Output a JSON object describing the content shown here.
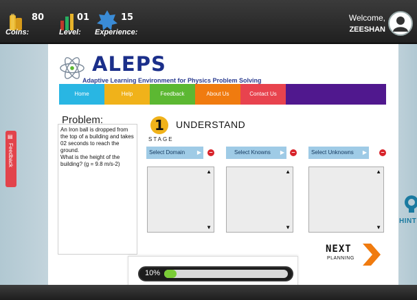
{
  "topbar": {
    "coins_value": "80",
    "coins_label": "Coins:",
    "level_value": "01",
    "level_label": "Level:",
    "experience_value": "15",
    "experience_label": "Experience:",
    "welcome_text": "Welcome,",
    "username": "ZEESHAN"
  },
  "logo": {
    "title": "ALEPS",
    "subtitle": "Adaptive Learning Environment for Physics Problem Solving"
  },
  "nav": {
    "items": [
      {
        "label": "Home",
        "color": "#29b6e3"
      },
      {
        "label": "Help",
        "color": "#f0b21a"
      },
      {
        "label": "Feedback",
        "color": "#5cb832"
      },
      {
        "label": "About Us",
        "color": "#f07b0f"
      },
      {
        "label": "Contact Us",
        "color": "#e8434e"
      }
    ]
  },
  "problem": {
    "title": "Problem:",
    "text": "An Iron ball is dropped from the top of a building and takes 02 seconds to reach the ground.\nWhat is the height of the building? (g = 9.8 m/s-2)"
  },
  "stage": {
    "number": "1",
    "name": "UNDERSTAND",
    "label": "STAGE"
  },
  "selectors": [
    {
      "label": "Select Domain"
    },
    {
      "label": "Select Knowns"
    },
    {
      "label": "Select Unknowns"
    }
  ],
  "next": {
    "label": "NEXT",
    "sublabel": "PLANNING"
  },
  "progress": {
    "text": "10%",
    "value": 10
  },
  "feedback_tab": {
    "label": "Feedback"
  },
  "hint": {
    "label": "HINT"
  }
}
